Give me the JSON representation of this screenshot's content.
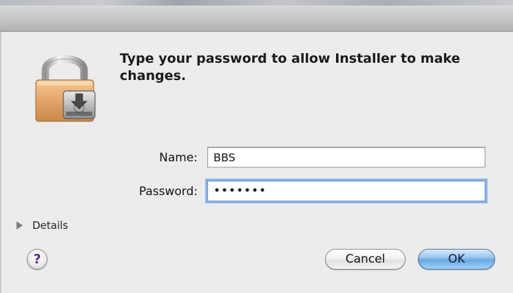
{
  "dialog": {
    "message": "Type your password to allow Installer to make changes.",
    "lock_icon": "lock-with-installer-package-icon"
  },
  "form": {
    "name_label": "Name:",
    "name_value": "BBS",
    "password_label": "Password:",
    "password_value": "•••••••"
  },
  "details": {
    "label": "Details",
    "icon": "disclosure-triangle-icon"
  },
  "buttons": {
    "help_label": "?",
    "cancel_label": "Cancel",
    "ok_label": "OK"
  },
  "colors": {
    "background": "#ececec",
    "focus_ring": "#8eb4e6",
    "default_button": "#6aa8e3",
    "lock_body": "#e3a46a"
  }
}
